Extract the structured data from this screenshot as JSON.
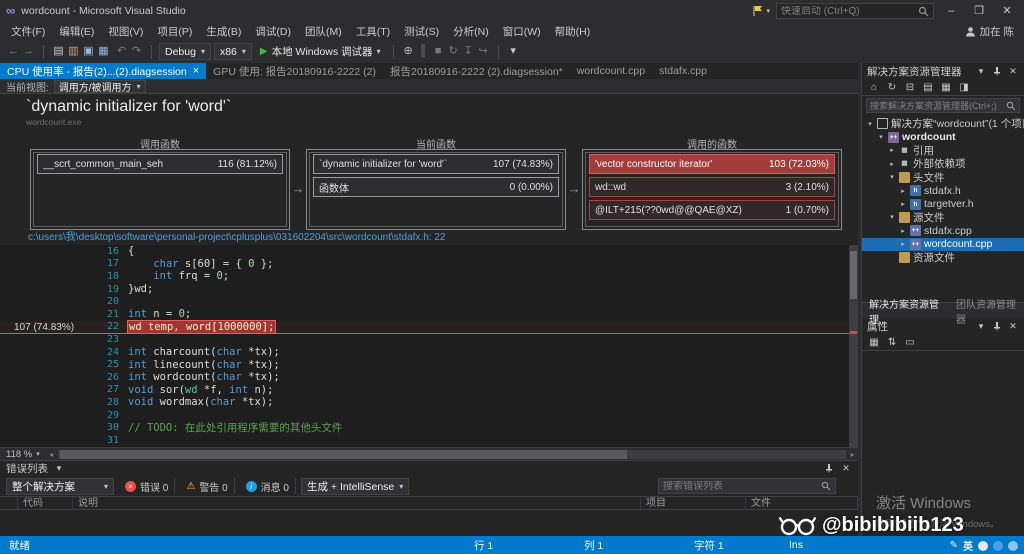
{
  "title_bar": {
    "title": "wordcount - Microsoft Visual Studio",
    "quick_launch_placeholder": "快速启动 (Ctrl+Q)"
  },
  "menu_bar": {
    "items": [
      "文件(F)",
      "编辑(E)",
      "视图(V)",
      "项目(P)",
      "生成(B)",
      "调试(D)",
      "团队(M)",
      "工具(T)",
      "测试(S)",
      "分析(N)",
      "窗口(W)",
      "帮助(H)"
    ],
    "user_name": "加在 陈"
  },
  "toolbar": {
    "icons_nav": [
      "back-icon",
      "forward-icon"
    ],
    "icons_file": [
      "new-file-icon",
      "open-file-icon",
      "save-icon",
      "save-all-icon"
    ],
    "icons_edit": [
      "undo-icon",
      "redo-icon"
    ],
    "config_value": "Debug",
    "platform_value": "x86",
    "run_label": "本地 Windows 调试器",
    "icons_debug": [
      "attach-process-icon",
      "break-all-icon",
      "stop-debug-icon",
      "restart-icon",
      "step-into-icon",
      "step-over-icon"
    ],
    "overflow_icon": "toolbar-overflow-icon"
  },
  "tabs": [
    {
      "label": "CPU 使用率 - 报告(2)...(2).diagsession",
      "active": true,
      "closable": true
    },
    {
      "label": "GPU 使用: 报告20180916-2222 (2)",
      "active": false
    },
    {
      "label": "报告20180916-2222 (2).diagsession*",
      "active": false
    },
    {
      "label": "wordcount.cpp",
      "active": false
    },
    {
      "label": "stdafx.cpp",
      "active": false
    }
  ],
  "view_bar": {
    "label": "当前视图:",
    "value": "调用方/被调用方"
  },
  "report": {
    "title": "`dynamic initializer for 'word'`",
    "subtitle": "wordcount.exe",
    "panels": [
      {
        "header": "调用函数",
        "rows": [
          {
            "name": "__scrt_common_main_seh",
            "value": "116 (81.12%)",
            "style": "normal"
          }
        ]
      },
      {
        "header": "当前函数",
        "rows": [
          {
            "name": "`dynamic initializer for 'word'`",
            "value": "107 (74.83%)",
            "style": "normal"
          },
          {
            "name": "函数体",
            "value": "0 (0.00%)",
            "style": "normal"
          }
        ]
      },
      {
        "header": "调用的函数",
        "rows": [
          {
            "name": "'vector constructor iterator'",
            "value": "103 (72.03%)",
            "style": "red-selected"
          },
          {
            "name": "wd::wd",
            "value": "3 (2.10%)",
            "style": "red-outline"
          },
          {
            "name": "@ILT+215(??0wd@@QAE@XZ)",
            "value": "1 (0.70%)",
            "style": "red-outline"
          }
        ]
      }
    ],
    "file_link": "c:\\users\\我\\desktop\\software\\personal-project\\cplusplus\\031602204\\src\\wordcount\\stdafx.h: 22"
  },
  "editor": {
    "zoom": "118 %",
    "annotation": {
      "line": 22,
      "text": "107 (74.83%)"
    },
    "lines": [
      {
        "num": 16,
        "segs": [
          {
            "t": "{"
          }
        ]
      },
      {
        "num": 17,
        "segs": [
          {
            "t": "    "
          },
          {
            "t": "char",
            "c": "kw"
          },
          {
            "t": " s[60] = { "
          },
          {
            "t": "0",
            "c": "num"
          },
          {
            "t": " };"
          }
        ]
      },
      {
        "num": 18,
        "segs": [
          {
            "t": "    "
          },
          {
            "t": "int",
            "c": "kw"
          },
          {
            "t": " frq = "
          },
          {
            "t": "0",
            "c": "num"
          },
          {
            "t": ";"
          }
        ]
      },
      {
        "num": 19,
        "segs": [
          {
            "t": "}wd;"
          }
        ]
      },
      {
        "num": 20,
        "segs": []
      },
      {
        "num": 21,
        "segs": [
          {
            "t": "int",
            "c": "kw"
          },
          {
            "t": " n = "
          },
          {
            "t": "0",
            "c": "num"
          },
          {
            "t": ";"
          }
        ]
      },
      {
        "num": 22,
        "highlight": true,
        "segs": [
          {
            "t": "wd",
            "c": "type"
          },
          {
            "t": " temp, word["
          },
          {
            "t": "1000000",
            "c": "num"
          },
          {
            "t": "];"
          }
        ]
      },
      {
        "num": 23,
        "segs": []
      },
      {
        "num": 24,
        "segs": [
          {
            "t": "int",
            "c": "kw"
          },
          {
            "t": " charcount("
          },
          {
            "t": "char",
            "c": "kw"
          },
          {
            "t": " *tx);"
          }
        ]
      },
      {
        "num": 25,
        "segs": [
          {
            "t": "int",
            "c": "kw"
          },
          {
            "t": " linecount("
          },
          {
            "t": "char",
            "c": "kw"
          },
          {
            "t": " *tx);"
          }
        ]
      },
      {
        "num": 26,
        "segs": [
          {
            "t": "int",
            "c": "kw"
          },
          {
            "t": " wordcount("
          },
          {
            "t": "char",
            "c": "kw"
          },
          {
            "t": " *tx);"
          }
        ]
      },
      {
        "num": 27,
        "segs": [
          {
            "t": "void",
            "c": "kw"
          },
          {
            "t": " sor("
          },
          {
            "t": "wd",
            "c": "type"
          },
          {
            "t": " *f, "
          },
          {
            "t": "int",
            "c": "kw"
          },
          {
            "t": " n);"
          }
        ]
      },
      {
        "num": 28,
        "segs": [
          {
            "t": "void",
            "c": "kw"
          },
          {
            "t": " wordmax("
          },
          {
            "t": "char",
            "c": "kw"
          },
          {
            "t": " *tx);"
          }
        ]
      },
      {
        "num": 29,
        "segs": []
      },
      {
        "num": 30,
        "segs": [
          {
            "t": "// TODO: 在此处引用程序需要的其他头文件",
            "c": "comment"
          }
        ]
      },
      {
        "num": 31,
        "segs": []
      }
    ]
  },
  "error_list": {
    "title": "错误列表",
    "scope_value": "整个解决方案",
    "error_label": "错误 0",
    "warning_label": "警告 0",
    "message_label": "消息 0",
    "filter_value": "生成 + IntelliSense",
    "search_placeholder": "搜索错误列表",
    "columns": [
      "代码",
      "说明",
      "项目",
      "文件"
    ]
  },
  "solution_explorer": {
    "title": "解决方案资源管理器",
    "toolbar_icons": [
      "home-icon",
      "sync-icon",
      "collapse-all-icon",
      "show-all-files-icon",
      "properties-icon",
      "preview-icon"
    ],
    "search_placeholder": "搜索解决方案资源管理器(Ctrl+;)",
    "tree": [
      {
        "label": "解决方案“wordcount”(1 个项目)",
        "icon": "solution-icon",
        "indent": 0,
        "expand": "expanded"
      },
      {
        "label": "wordcount",
        "icon": "cpp-project-icon",
        "indent": 1,
        "expand": "expanded",
        "bold": true
      },
      {
        "label": "引用",
        "icon": "references-icon",
        "indent": 2,
        "expand": "collapsed"
      },
      {
        "label": "外部依赖项",
        "icon": "dependencies-icon",
        "indent": 2,
        "expand": "collapsed"
      },
      {
        "label": "头文件",
        "icon": "folder-icon",
        "indent": 2,
        "expand": "expanded"
      },
      {
        "label": "stdafx.h",
        "icon": "header-file-icon",
        "indent": 3,
        "expand": "collapsed"
      },
      {
        "label": "targetver.h",
        "icon": "header-file-icon",
        "indent": 3,
        "expand": "collapsed"
      },
      {
        "label": "源文件",
        "icon": "folder-icon",
        "indent": 2,
        "expand": "expanded"
      },
      {
        "label": "stdafx.cpp",
        "icon": "cpp-file-icon",
        "indent": 3,
        "expand": "collapsed"
      },
      {
        "label": "wordcount.cpp",
        "icon": "cpp-file-icon",
        "indent": 3,
        "expand": "collapsed",
        "selected": true
      },
      {
        "label": "资源文件",
        "icon": "folder-icon",
        "indent": 2,
        "expand": "none"
      }
    ],
    "bottom_tabs": [
      {
        "label": "解决方案资源管理...",
        "active": true
      },
      {
        "label": "团队资源管理器",
        "active": false
      }
    ]
  },
  "properties_panel": {
    "title": "属性",
    "toolbar_icons": [
      "categorized-icon",
      "alphabetical-icon",
      "property-pages-icon"
    ]
  },
  "status_bar": {
    "ready": "就绪",
    "line": "行 1",
    "column": "列 1",
    "char": "字符 1",
    "mode": "Ins"
  },
  "watermarks": {
    "activate_title": "激活 Windows",
    "activate_subtitle": "转到“设置”以激活 Windows。",
    "weibo_handle": "@bibibibiib123"
  },
  "tray": {
    "ime_label": "英"
  }
}
